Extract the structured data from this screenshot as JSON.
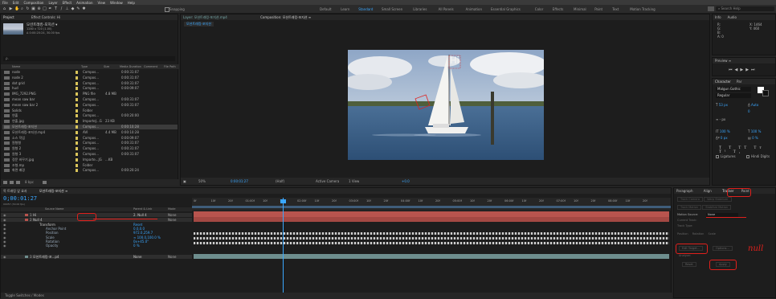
{
  "menu": [
    "File",
    "Edit",
    "Composition",
    "Layer",
    "Effect",
    "Animation",
    "View",
    "Window",
    "Help"
  ],
  "toolbar": {
    "snapping": "Snapping",
    "workspaces": [
      "Default",
      "Learn",
      "Standard",
      "Small Screen",
      "Libraries",
      "All Panels",
      "Animation",
      "Essential Graphics",
      "Color",
      "Effects",
      "Minimal",
      "Paint",
      "Text",
      "Motion Tracking"
    ],
    "active_workspace": "Standard",
    "search_placeholder": "Search Help"
  },
  "project": {
    "tab": "Project",
    "tab2": "Effect Controls: Hi",
    "comp_name": "모션트래킹-포지션 ▾",
    "comp_info1": "1280 x 720 (1.00)",
    "comp_info2": "Δ 0:00:20:24, 30.00 fps",
    "search_placeholder": "ρ.",
    "columns": {
      "name": "Name",
      "type": "Type",
      "size": "Size",
      "duration": "Media Duration",
      "comment": "Comment",
      "path": "File Path"
    },
    "rows": [
      {
        "name": "node",
        "type": "Compos...",
        "size": "",
        "dur": "0:00:31:07"
      },
      {
        "name": "node 2",
        "type": "Compos...",
        "size": "",
        "dur": "0:00:31:07"
      },
      {
        "name": "dot grid",
        "type": "Compos...",
        "size": "",
        "dur": "0:00:31:07"
      },
      {
        "name": "hud",
        "type": "Compos...",
        "size": "",
        "dur": "0:00:09:07"
      },
      {
        "name": "IMG_7292.PNG",
        "type": "PNG file",
        "size": "4.8 MB",
        "dur": ""
      },
      {
        "name": "mean saw bar",
        "type": "Compos...",
        "size": "",
        "dur": "0:00:31:07"
      },
      {
        "name": "mean saw bar 2",
        "type": "Compos...",
        "size": "",
        "dur": "0:00:31:07"
      },
      {
        "name": "Solids",
        "type": "Folder",
        "size": "",
        "dur": ""
      },
      {
        "name": "연출",
        "type": "Compos...",
        "size": "",
        "dur": "0:00:20:00"
      },
      {
        "name": "연출.jpg",
        "type": "ImporteJ...G",
        "size": "23 KB",
        "dur": ""
      },
      {
        "name": "모션트래킹-포지션",
        "type": "Compos...",
        "size": "",
        "dur": "0:00:10:28"
      },
      {
        "name": "모션트래킹-포지션.mp4",
        "type": "AVI",
        "size": "4.4 MB",
        "dur": "0:00:10:28"
      },
      {
        "name": "소스 작업",
        "type": "Compos...",
        "size": "",
        "dur": "0:00:09:07"
      },
      {
        "name": "원형형",
        "type": "Compos...",
        "size": "",
        "dur": "0:00:31:07"
      },
      {
        "name": "원형 2",
        "type": "Compos...",
        "size": "",
        "dur": "0:00:31:07"
      },
      {
        "name": "원형 3",
        "type": "Compos...",
        "size": "",
        "dur": "0:00:31:07"
      },
      {
        "name": "정문 바꾸기.jpg",
        "type": "Importe...JG",
        "size": "...KB",
        "dur": ""
      },
      {
        "name": "조형.mp",
        "type": "Folder",
        "size": "",
        "dur": ""
      },
      {
        "name": "화면 배경",
        "type": "Compos...",
        "size": "",
        "dur": "0:00:20:24"
      }
    ],
    "bpc": "8 bpc"
  },
  "viewer": {
    "tab_layer": "Layer: 모션트래킹-포지션.mp4",
    "tab_comp": "Composition: 모션트래킹-포지션 ≡",
    "comp_subtab": "모션트래킹-포지션",
    "overlay_text": "Hi",
    "bottom": {
      "zoom": "50%",
      "time": "0:00:01:27",
      "res": "(Half)",
      "camera": "Active Camera",
      "view": "1 View",
      "exposure": "+0.0"
    }
  },
  "info": {
    "tab": "Info",
    "audio": "Audio",
    "r": "R:",
    "g": "G:",
    "b": "B:",
    "a": "A: 0",
    "x": "X: 1464",
    "y": "Y: 460"
  },
  "preview": {
    "tab": "Preview ≡"
  },
  "character": {
    "tabs": [
      "Character",
      "Par"
    ],
    "font": "Malgun Gothic",
    "style": "Regular",
    "size": "53 px",
    "leading": "Auto",
    "tracking": "0",
    "stroke": "- px",
    "vscale": "100 %",
    "hscale": "100 %",
    "baseline": "0 px",
    "tsume": "0 %",
    "ligatures": "Ligatures",
    "hindi": "Hindi Digits"
  },
  "timeline": {
    "tab1": "목 트래킹 앞 효과",
    "tab2": "모션트래킹-포지션 ≡",
    "timecode": "0;00:01:27",
    "timecode_sub": "00057 (30.00 fps)",
    "col_source": "Source Name",
    "col_parent": "Parent & Link",
    "col_mode": "Mode",
    "ruler": [
      "0f",
      "10f",
      "20f",
      "01:00f",
      "10f",
      "20f",
      "02:00f",
      "10f",
      "20f",
      "03:00f",
      "10f",
      "20f",
      "04:00f",
      "10f",
      "20f",
      "05:00f",
      "10f",
      "20f",
      "06:00f",
      "10f",
      "20f",
      "07:00f",
      "10f",
      "20f",
      "08:00f",
      "10f",
      "20f"
    ],
    "layers": [
      {
        "num": "1",
        "name": "Hi",
        "parent": "2. Null 4",
        "mode": "None"
      },
      {
        "num": "2",
        "name": "Null 4",
        "parent": "",
        "mode": "None"
      },
      {
        "num": "",
        "name": "Transform",
        "parent": "Reset",
        "mode": ""
      },
      {
        "num": "",
        "name": "Anchor Point",
        "parent": "0.0,0.0",
        "mode": ""
      },
      {
        "num": "",
        "name": "Position",
        "parent": "972.0,259.7",
        "mode": ""
      },
      {
        "num": "",
        "name": "Scale",
        "parent": "∞ 100.0,100.0 %",
        "mode": ""
      },
      {
        "num": "",
        "name": "Rotation",
        "parent": "0x+45.0°",
        "mode": ""
      },
      {
        "num": "",
        "name": "Opacity",
        "parent": "0 %",
        "mode": ""
      },
      {
        "num": "3",
        "name": "모션트래킹-포...p4",
        "parent": "None",
        "mode": "None"
      }
    ],
    "toggle": "Toggle Switches / Modes"
  },
  "tracker": {
    "tabs": [
      "Paragraph",
      "Align",
      "Tracker",
      "Paint"
    ],
    "active_tab": "Tracker",
    "motion_source_label": "Motion Source:",
    "motion_source": "None",
    "current_track_label": "Current Track:",
    "track_type_label": "Track Type:",
    "checks": [
      "Position",
      "Rotation",
      "Scale"
    ],
    "buttons": [
      "Edit Target...",
      "Options...",
      "Analyze:",
      "Reset",
      "Apply"
    ],
    "annotation": "null"
  },
  "colors": {
    "accent": "#3aa7ff",
    "layer_red": "#b8544e",
    "annotation_red": "#e0201c",
    "timecode": "#3aa7ff"
  }
}
